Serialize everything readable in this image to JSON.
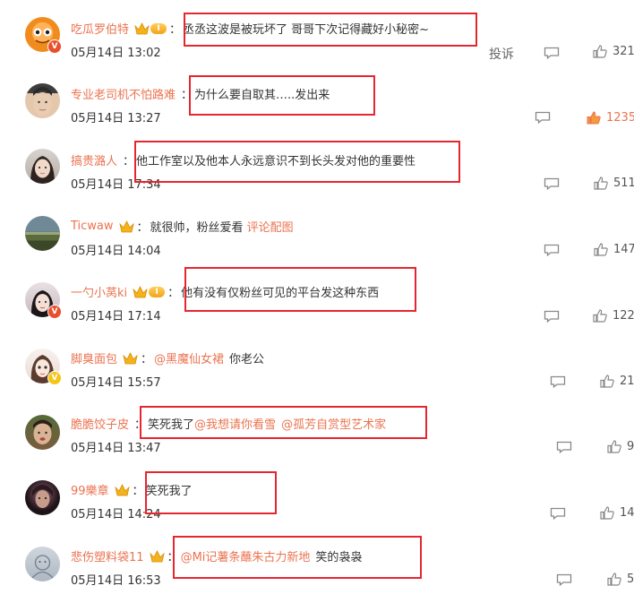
{
  "report_label": "投诉",
  "comments": [
    {
      "username": "吃瓜罗伯特",
      "has_crown": true,
      "level": "I",
      "text": "丞丞这波是被玩坏了 哥哥下次记得藏好小秘密~",
      "date": "05月14日 13:02",
      "likes": "321",
      "show_report": true,
      "verified": true,
      "hot": false
    },
    {
      "username": "专业老司机不怕路难",
      "has_crown": false,
      "text": "为什么要自取其…..发出来",
      "date": "05月14日 13:27",
      "likes": "1235",
      "verified": false,
      "hot": true
    },
    {
      "username": "搞贵潞人",
      "has_crown": false,
      "text": "他工作室以及他本人永远意识不到长头发对他的重要性",
      "date": "05月14日 17:34",
      "likes": "511",
      "verified": false,
      "hot": false
    },
    {
      "username": "Ticwaw",
      "has_crown": true,
      "text": "就很帅，粉丝爱看",
      "link": "评论配图",
      "date": "05月14日 14:04",
      "likes": "147",
      "verified": false,
      "hot": false
    },
    {
      "username": "一勺小莴ki",
      "has_crown": true,
      "level": "I",
      "text": "他有没有仅粉丝可见的平台发这种东西",
      "date": "05月14日 17:14",
      "likes": "122",
      "verified": true,
      "hot": false
    },
    {
      "username": "脚臭面包",
      "has_crown": true,
      "mention": "@黑魔仙女裙",
      "text": "你老公",
      "date": "05月14日 15:57",
      "likes": "21",
      "verified": true,
      "verified_color": "#f5c518",
      "hot": false
    },
    {
      "username": "脆脆饺子皮",
      "has_crown": false,
      "text": "笑死我了",
      "mention": "@我想请你看雪",
      "mention2": "@孤芳自赏型艺术家",
      "date": "05月14日 13:47",
      "likes": "9",
      "verified": false,
      "hot": false
    },
    {
      "username": "99樂章",
      "has_crown": true,
      "text": "笑死我了",
      "date": "05月14日 14:24",
      "likes": "14",
      "verified": false,
      "hot": false
    },
    {
      "username": "悲伤塑料袋11",
      "has_crown": true,
      "mention": "@Mi记薯条蘸朱古力新地",
      "text": "笑的袅袅",
      "date": "05月14日 16:53",
      "likes": "5",
      "verified": false,
      "hot": false
    }
  ],
  "colors": {
    "username": "#eb7350",
    "highlight_box": "#e6262e",
    "text": "#333333"
  }
}
